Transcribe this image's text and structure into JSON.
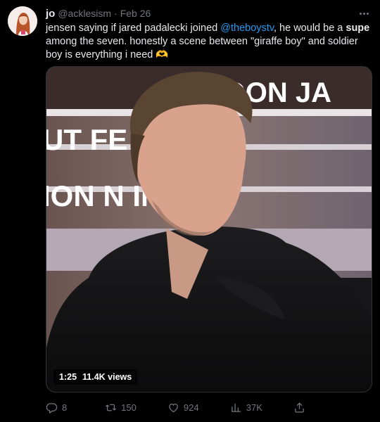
{
  "tweet": {
    "display_name": "jo",
    "handle": "@acklesism",
    "separator": "·",
    "date": "Feb 26",
    "text": {
      "part1": "jensen saying if jared padalecki joined ",
      "mention": "@theboystv",
      "part2": ", he would be a ",
      "bold": "supe",
      "part3": " among the seven. honestly a scene between \"giraffe boy\" and soldier boy is everything i need ",
      "emoji": "🫶"
    },
    "media": {
      "duration": "1:25",
      "views": "11.4K views",
      "banner_lines": [
        "POON JA",
        "UT   FE ULTIM",
        "ION    N IN PI"
      ]
    },
    "actions": {
      "replies": "8",
      "retweets": "150",
      "likes": "924",
      "views": "37K"
    }
  },
  "icons": {
    "reply": "reply-icon",
    "retweet": "retweet-icon",
    "like": "heart-icon",
    "views": "analytics-icon",
    "share": "share-icon",
    "more": "more-icon"
  },
  "colors": {
    "background": "#000000",
    "text": "#e7e9ea",
    "muted": "#71767b",
    "link": "#1d9bf0"
  }
}
